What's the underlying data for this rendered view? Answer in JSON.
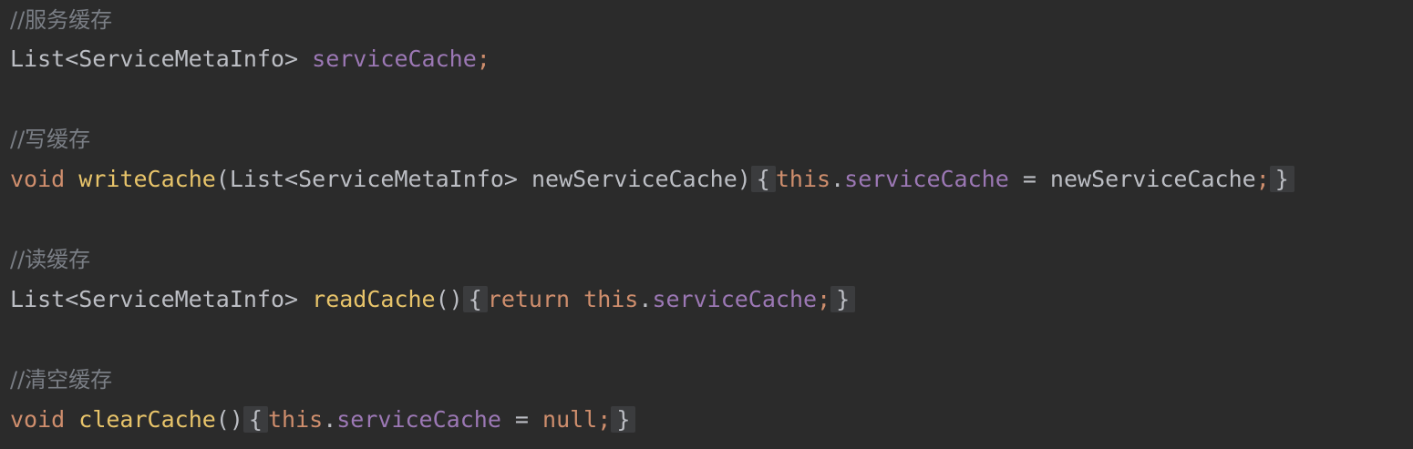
{
  "lines": [
    {
      "comment": "//服务缓存"
    },
    {
      "type": "List<ServiceMetaInfo>",
      "field": "serviceCache",
      "semi": ";"
    },
    {
      "comment": "//写缓存"
    },
    {
      "kw": "void",
      "fn": "writeCache",
      "params": "(List<ServiceMetaInfo> newServiceCache)",
      "open": "{",
      "this": "this",
      "dot": ".",
      "field": "serviceCache",
      "op": " = newServiceCache",
      "semi": ";",
      "close": "}"
    },
    {
      "comment": "//读缓存"
    },
    {
      "type": "List<ServiceMetaInfo>",
      "fn": "readCache",
      "params": "()",
      "open": "{",
      "return": "return",
      "this": "this",
      "dot": ".",
      "field": "serviceCache",
      "semi": ";",
      "close": "}"
    },
    {
      "comment": "//清空缓存"
    },
    {
      "kw": "void",
      "fn": "clearCache",
      "params": "()",
      "open": "{",
      "this": "this",
      "dot": ".",
      "field": "serviceCache",
      "op": " = ",
      "null": "null",
      "semi": ";",
      "close": "}"
    }
  ],
  "colors": {
    "background": "#2b2b2b",
    "comment": "#7a7e85",
    "keyword": "#cf8e6d",
    "function": "#e8c46a",
    "field": "#9c78b5",
    "plain": "#bcbec4",
    "fold_background": "#3b3c3e"
  }
}
